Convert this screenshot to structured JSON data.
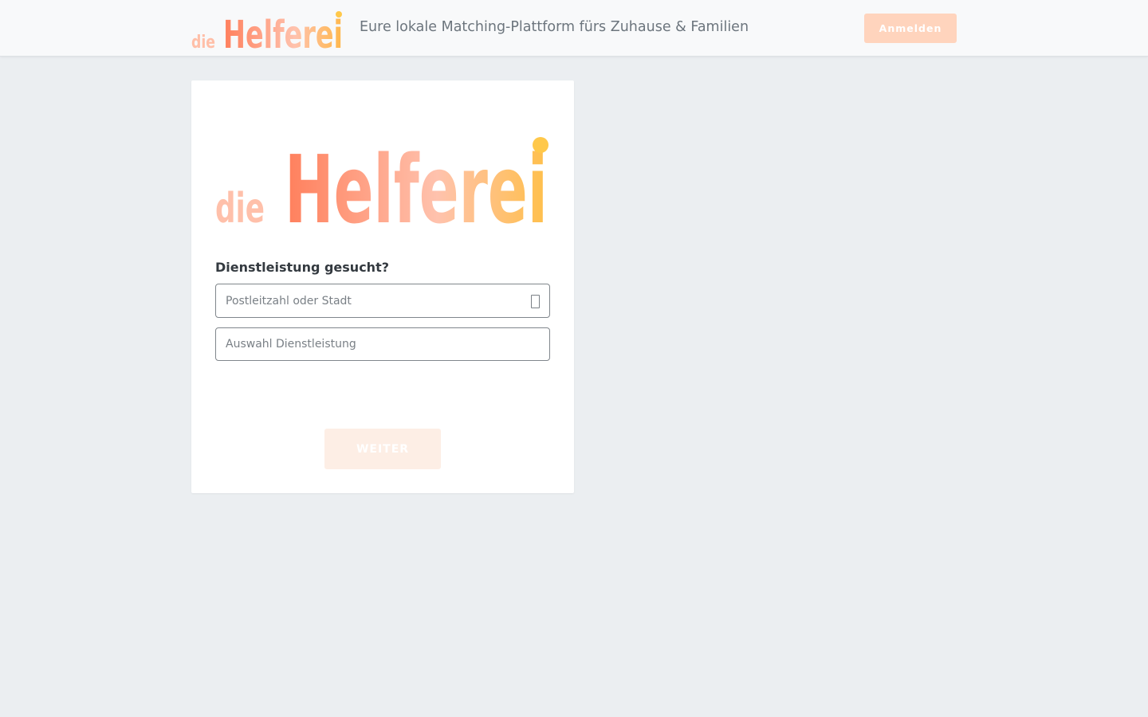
{
  "header": {
    "logo": {
      "prefix": "die",
      "name": "Helferei",
      "icon": "helferei-logo"
    },
    "tagline": "Eure lokale Matching-Plattform fürs Zuhause & Familien",
    "login_label": "Anmelden"
  },
  "card": {
    "logo": {
      "prefix": "die",
      "name": "Helferei",
      "icon": "helferei-logo"
    },
    "heading": "Dienstleistung gesucht?",
    "location_input": {
      "value": "",
      "placeholder": "Postleitzahl oder Stadt",
      "icon": "location-icon"
    },
    "service_input": {
      "value": "",
      "placeholder": "Auswahl Dienstleistung"
    },
    "submit_label": "WEITER"
  },
  "colors": {
    "brand_orange": "#ff7f5c",
    "brand_peach": "#ffc2ad",
    "brand_yellow": "#ffc84a",
    "login_button": "#ffd4bd",
    "submit_button_disabled": "#fdeee5",
    "background": "#ebeef1"
  }
}
